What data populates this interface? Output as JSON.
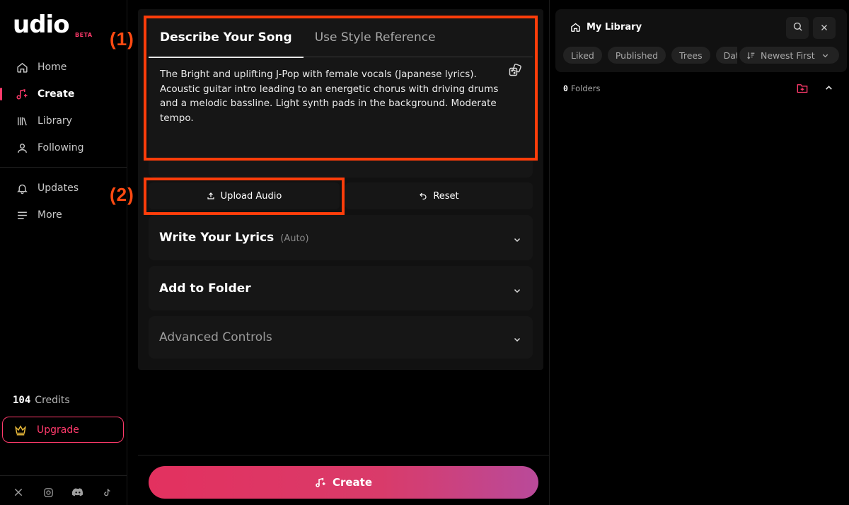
{
  "app": {
    "logo_text": "udio",
    "logo_badge": "BETA"
  },
  "sidebar": {
    "items": [
      {
        "label": "Home",
        "icon": "home-icon"
      },
      {
        "label": "Create",
        "icon": "music-plus-icon",
        "active": true
      },
      {
        "label": "Library",
        "icon": "library-icon"
      },
      {
        "label": "Following",
        "icon": "user-icon"
      },
      {
        "label": "Updates",
        "icon": "bell-icon"
      },
      {
        "label": "More",
        "icon": "menu-icon"
      }
    ],
    "credits_count": "104",
    "credits_label": "Credits",
    "upgrade_label": "Upgrade",
    "socials": [
      "x-icon",
      "instagram-icon",
      "discord-icon",
      "tiktok-icon"
    ]
  },
  "annotations": {
    "one": "(1)",
    "two": "(2)"
  },
  "create": {
    "tabs": [
      {
        "label": "Describe Your Song",
        "active": true
      },
      {
        "label": "Use Style Reference",
        "active": false
      }
    ],
    "prompt_text": "The Bright and uplifting J-Pop with female vocals (Japanese lyrics). Acoustic guitar intro leading to an energetic chorus with driving drums and a melodic bassline. Light synth pads in the background. Moderate tempo.",
    "upload_label": "Upload Audio",
    "reset_label": "Reset",
    "lyrics_title": "Write Your Lyrics",
    "lyrics_sub": "(Auto)",
    "folder_title": "Add to Folder",
    "advanced_title": "Advanced Controls",
    "create_label": "Create"
  },
  "library": {
    "title": "My Library",
    "chips": [
      "Liked",
      "Published",
      "Trees",
      "Date"
    ],
    "sort_label": "Newest First",
    "folders_count": "0",
    "folders_label": "Folders"
  },
  "colors": {
    "accent": "#ff3a6b",
    "annotation": "#ff3d0a",
    "panel": "#111111",
    "card": "#161616"
  }
}
